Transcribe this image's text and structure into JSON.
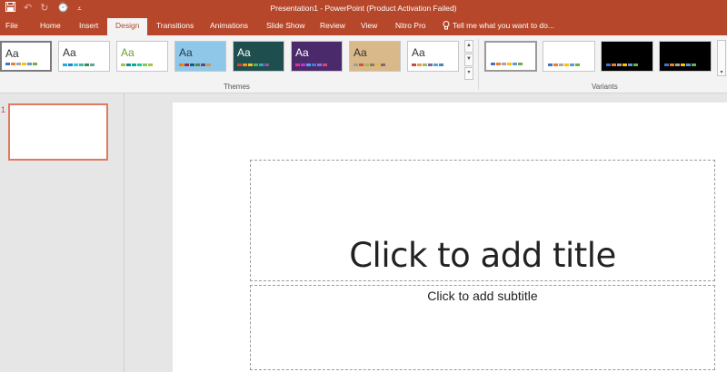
{
  "window": {
    "title": "Presentation1 - PowerPoint (Product Activation Failed)"
  },
  "quick_access": {
    "icons": [
      "save-icon",
      "undo-icon",
      "redo-icon",
      "start-from-beginning-icon",
      "customize-icon"
    ]
  },
  "tabs": [
    {
      "label": "File"
    },
    {
      "label": "Home"
    },
    {
      "label": "Insert"
    },
    {
      "label": "Design"
    },
    {
      "label": "Transitions"
    },
    {
      "label": "Animations"
    },
    {
      "label": "Slide Show"
    },
    {
      "label": "Review"
    },
    {
      "label": "View"
    },
    {
      "label": "Nitro Pro"
    }
  ],
  "active_tab": "Design",
  "tell_me": {
    "label": "Tell me what you want to do..."
  },
  "themes": {
    "group_label": "Themes",
    "items": [
      {
        "label": "Aa",
        "bg": "#ffffff",
        "fg": "#333333",
        "bars": [
          "#4472c4",
          "#ed7d31",
          "#a5a5a5",
          "#ffc000",
          "#5b9bd5",
          "#70ad47"
        ]
      },
      {
        "label": "Aa",
        "bg": "#ffffff",
        "fg": "#333333",
        "bars": [
          "#1cade4",
          "#2683c6",
          "#27ced7",
          "#42ba97",
          "#3e8853",
          "#62a39f"
        ]
      },
      {
        "label": "Aa",
        "bg": "#ffffff",
        "fg": "#6ca033",
        "bars": [
          "#a5c249",
          "#0e8c9c",
          "#0faa8c",
          "#10cf9b",
          "#7cca62",
          "#a5c249"
        ]
      },
      {
        "label": "Aa",
        "bg": "#8fc7e8",
        "fg": "#1f3b4d",
        "bars": [
          "#f07f09",
          "#9f2936",
          "#1b587c",
          "#4e8542",
          "#604878",
          "#c19859"
        ]
      },
      {
        "label": "Aa",
        "bg": "#1f4e4e",
        "fg": "#ffffff",
        "bars": [
          "#e43e35",
          "#f59425",
          "#f0c419",
          "#52b65f",
          "#35a6c4",
          "#8559a5"
        ]
      },
      {
        "label": "Aa",
        "bg": "#4b2a6b",
        "fg": "#ffffff",
        "bars": [
          "#e32d91",
          "#c830cc",
          "#4ea6dc",
          "#4775e7",
          "#8971e1",
          "#d54773"
        ]
      },
      {
        "label": "Aa",
        "bg": "#d9b98a",
        "fg": "#333333",
        "bars": [
          "#93a299",
          "#cf543f",
          "#b5ae53",
          "#848058",
          "#e8b54d",
          "#786c71"
        ]
      },
      {
        "label": "Aa",
        "bg": "#ffffff",
        "fg": "#333333",
        "bars": [
          "#c0504d",
          "#f79646",
          "#9bbb59",
          "#8064a2",
          "#4bacc6",
          "#4f81bd"
        ]
      }
    ]
  },
  "variants": {
    "group_label": "Variants",
    "items": [
      {
        "bg": "#ffffff",
        "bars": [
          "#4472c4",
          "#ed7d31",
          "#a5a5a5",
          "#ffc000",
          "#5b9bd5",
          "#70ad47"
        ]
      },
      {
        "bg": "#ffffff",
        "bars": [
          "#4472c4",
          "#ed7d31",
          "#a5a5a5",
          "#ffc000",
          "#5b9bd5",
          "#70ad47"
        ]
      },
      {
        "bg": "#000000",
        "bars": [
          "#4472c4",
          "#ed7d31",
          "#a5a5a5",
          "#ffc000",
          "#5b9bd5",
          "#70ad47"
        ]
      },
      {
        "bg": "#000000",
        "bars": [
          "#4472c4",
          "#ed7d31",
          "#a5a5a5",
          "#ffc000",
          "#5b9bd5",
          "#70ad47"
        ]
      }
    ]
  },
  "slides_pane": {
    "slide_number": "1"
  },
  "slide": {
    "title_placeholder": "Click to add title",
    "subtitle_placeholder": "Click to add subtitle"
  },
  "colors": {
    "accent": "#b7472a",
    "ribbon_bg": "#f3f3f3",
    "thumb_border": "#e0795f"
  }
}
